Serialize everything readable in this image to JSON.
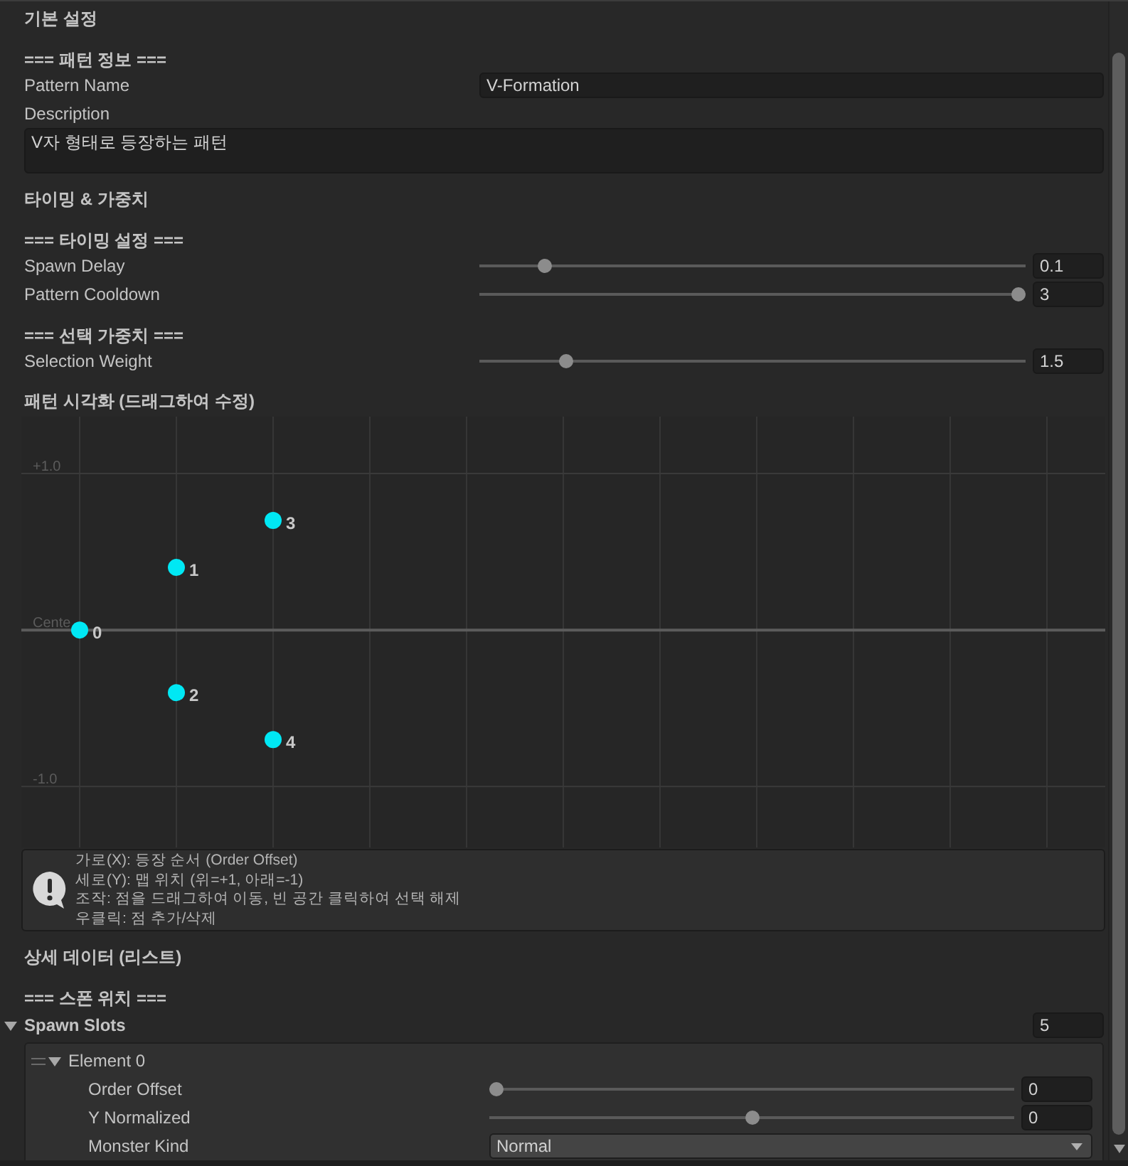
{
  "sections": [
    {
      "title": "기본 설정",
      "groups": [
        {
          "header": "=== 패턴 정보 ===",
          "fields": [
            {
              "kind": "text",
              "label": "Pattern Name",
              "value": "V-Formation"
            },
            {
              "kind": "textarea",
              "label": "Description",
              "value": "V자 형태로 등장하는 패턴"
            }
          ]
        }
      ]
    },
    {
      "title": "타이밍 & 가중치",
      "groups": [
        {
          "header": "=== 타이밍 설정 ===",
          "fields": [
            {
              "kind": "slider",
              "label": "Spawn Delay",
              "level": 0.11,
              "value": "0.1"
            },
            {
              "kind": "slider",
              "label": "Pattern Cooldown",
              "level": 1,
              "value": "3"
            }
          ]
        },
        {
          "header": "=== 선택 가중치 ===",
          "fields": [
            {
              "kind": "slider",
              "label": "Selection Weight",
              "level": 0.15,
              "value": "1.5"
            }
          ]
        }
      ]
    },
    {
      "title": "패턴 시각화 (드래그하여 수정)",
      "graph": {
        "chart_data": {
          "type": "scatter",
          "categories": [
            null,
            null,
            null,
            null,
            null,
            null,
            null,
            null,
            null,
            null,
            null
          ],
          "series": [
            {
              "values": [
                0,
                0.4,
                0.7,
                null,
                null,
                null,
                null,
                null,
                null,
                null,
                null
              ]
            },
            {
              "values": [
                null,
                -0.4,
                -0.7,
                null,
                null,
                null,
                null,
                null,
                null,
                null,
                null
              ]
            }
          ],
          "grid": true,
          "ylim": [
            -1.39,
            1.364
          ],
          "yticks": [
            {
              "value": 1,
              "label": "+1.0"
            },
            {
              "value": 0,
              "label": "Cente"
            },
            {
              "value": -1,
              "label": "-1.0"
            }
          ]
        },
        "point_labels": [
          [
            "0",
            "1",
            "3"
          ],
          [
            "2",
            "4"
          ]
        ]
      },
      "help": {
        "lines": [
          "가로(X): 등장 순서 (Order Offset)",
          "세로(Y): 맵 위치 (위=+1, 아래=-1)",
          "조작: 점을 드래그하여 이동, 빈 공간 클릭하여 선택 해제",
          "우클릭: 점 추가/삭제"
        ]
      }
    },
    {
      "title": "상세 데이터 (리스트)",
      "groups": [
        {
          "header": "=== 스폰 위치 ===",
          "list": {
            "label": "Spawn Slots",
            "expanded": true,
            "size": "5",
            "elements": [
              {
                "label": "Element 0",
                "expanded": true,
                "fields": [
                  {
                    "kind": "slider",
                    "label": "Order Offset",
                    "level": 0,
                    "value": "0"
                  },
                  {
                    "kind": "slider",
                    "label": "Y Normalized",
                    "level": 0.5,
                    "value": "0"
                  },
                  {
                    "kind": "dropdown",
                    "label": "Monster Kind",
                    "value": "Normal"
                  }
                ]
              }
            ]
          }
        }
      ]
    }
  ]
}
